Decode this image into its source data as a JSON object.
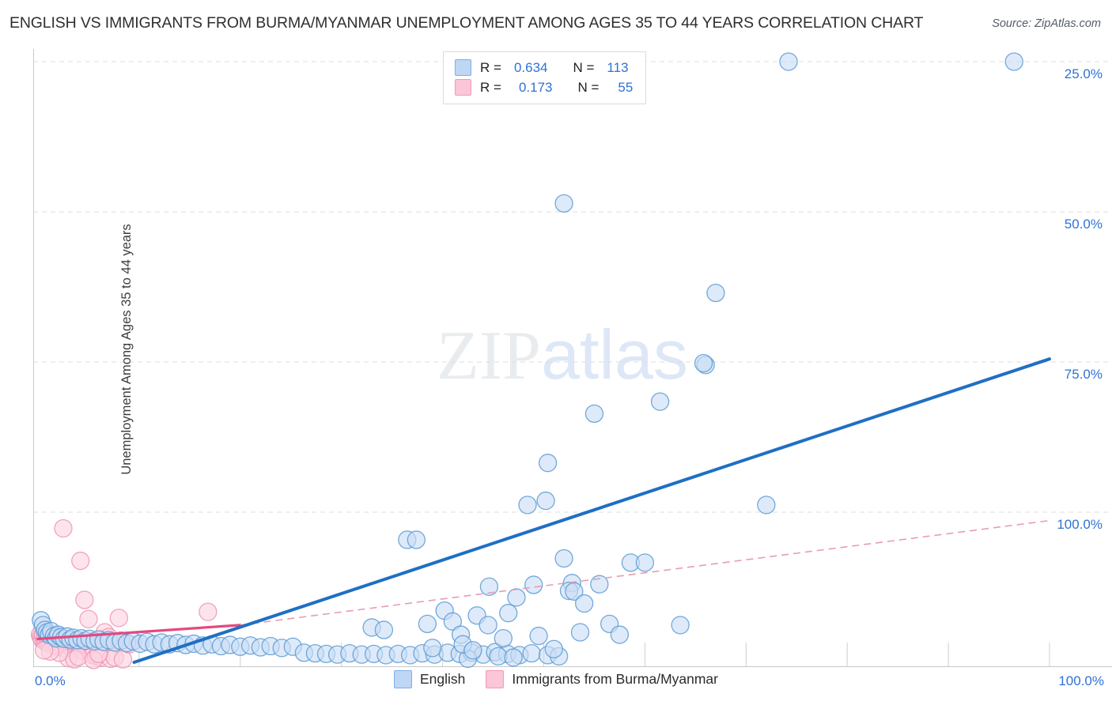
{
  "header": {
    "title": "ENGLISH VS IMMIGRANTS FROM BURMA/MYANMAR UNEMPLOYMENT AMONG AGES 35 TO 44 YEARS CORRELATION CHART",
    "source": "Source: ZipAtlas.com"
  },
  "watermark": {
    "part1": "ZIP",
    "part2": "atlas"
  },
  "stats": {
    "rows": [
      {
        "series": "English",
        "r_label": "R =",
        "r_value": "0.634",
        "n_label": "N =",
        "n_value": "113",
        "color": "#bdd7f5"
      },
      {
        "series": "Immigrants from Burma/Myanmar",
        "r_label": "R =",
        "r_value": "0.173",
        "n_label": "N =",
        "n_value": "55",
        "color": "#fbc6d8"
      }
    ]
  },
  "legend": {
    "items": [
      {
        "label": "English",
        "color": "#bdd7f5",
        "border": "#80aee4"
      },
      {
        "label": "Immigrants from Burma/Myanmar",
        "color": "#fbc6d8",
        "border": "#f29ab8"
      }
    ]
  },
  "axes": {
    "y_title": "Unemployment Among Ages 35 to 44 years",
    "y_ticks": [
      "100.0%",
      "75.0%",
      "50.0%",
      "25.0%"
    ],
    "x_min_label": "0.0%",
    "x_max_label": "100.0%"
  },
  "colors": {
    "blue_fill": "#c9ddf6",
    "blue_stroke": "#5b9bd5",
    "pink_fill": "#fbd4e1",
    "pink_stroke": "#ef95b5",
    "blue_line": "#1f6fc4",
    "pink_line": "#e4497f",
    "pink_dash": "#e89cb4",
    "grid": "#dcdcdc",
    "tick_text": "#2f72d6"
  },
  "chart_data": {
    "type": "scatter",
    "title": "ENGLISH VS IMMIGRANTS FROM BURMA/MYANMAR UNEMPLOYMENT AMONG AGES 35 TO 44 YEARS CORRELATION CHART",
    "xlabel": "",
    "ylabel": "Unemployment Among Ages 35 to 44 years",
    "xlim": [
      0,
      100
    ],
    "ylim": [
      0,
      104
    ],
    "grid": true,
    "x_tick_values": [
      0,
      100
    ],
    "y_tick_values": [
      25,
      50,
      75,
      100
    ],
    "legend_position": "bottom-center",
    "series": [
      {
        "name": "English",
        "r": 0.634,
        "n": 113,
        "color": "#c9ddf6",
        "stroke": "#5b9bd5",
        "trend": {
          "type": "solid",
          "x0": 9.5,
          "y0": 0.0,
          "x1": 100.0,
          "y1": 50.5
        },
        "points": [
          [
            0.3,
            7.0
          ],
          [
            0.5,
            6.2
          ],
          [
            0.7,
            5.4
          ],
          [
            0.9,
            5.0
          ],
          [
            1.1,
            4.6
          ],
          [
            1.3,
            5.2
          ],
          [
            1.6,
            4.4
          ],
          [
            1.8,
            4.0
          ],
          [
            2.0,
            4.6
          ],
          [
            2.3,
            4.2
          ],
          [
            2.6,
            3.9
          ],
          [
            2.9,
            4.3
          ],
          [
            3.2,
            3.8
          ],
          [
            3.5,
            4.1
          ],
          [
            3.9,
            3.7
          ],
          [
            4.3,
            4.0
          ],
          [
            4.7,
            3.6
          ],
          [
            5.1,
            3.9
          ],
          [
            5.6,
            3.5
          ],
          [
            6.0,
            3.8
          ],
          [
            6.5,
            3.4
          ],
          [
            7.0,
            3.7
          ],
          [
            7.6,
            3.3
          ],
          [
            8.2,
            3.6
          ],
          [
            8.8,
            3.2
          ],
          [
            9.4,
            3.5
          ],
          [
            10.1,
            3.1
          ],
          [
            10.8,
            3.4
          ],
          [
            11.5,
            3.0
          ],
          [
            12.2,
            3.3
          ],
          [
            13.0,
            3.0
          ],
          [
            13.8,
            3.2
          ],
          [
            14.6,
            2.9
          ],
          [
            15.4,
            3.1
          ],
          [
            16.3,
            2.8
          ],
          [
            17.2,
            3.0
          ],
          [
            18.1,
            2.7
          ],
          [
            19.0,
            2.9
          ],
          [
            20.0,
            2.6
          ],
          [
            21.0,
            2.8
          ],
          [
            22.0,
            2.5
          ],
          [
            23.0,
            2.7
          ],
          [
            24.1,
            2.4
          ],
          [
            25.2,
            2.6
          ],
          [
            26.3,
            1.6
          ],
          [
            27.4,
            1.5
          ],
          [
            28.5,
            1.4
          ],
          [
            29.6,
            1.3
          ],
          [
            30.8,
            1.5
          ],
          [
            32.0,
            1.3
          ],
          [
            33.2,
            1.4
          ],
          [
            34.4,
            1.2
          ],
          [
            35.6,
            1.4
          ],
          [
            36.8,
            1.2
          ],
          [
            38.0,
            1.5
          ],
          [
            39.2,
            1.3
          ],
          [
            40.5,
            1.6
          ],
          [
            41.7,
            1.4
          ],
          [
            42.9,
            1.6
          ],
          [
            44.0,
            1.3
          ],
          [
            45.2,
            1.7
          ],
          [
            46.4,
            1.4
          ],
          [
            47.6,
            1.2
          ],
          [
            48.8,
            1.5
          ],
          [
            33.0,
            5.8
          ],
          [
            34.2,
            5.4
          ],
          [
            36.5,
            20.4
          ],
          [
            37.4,
            20.4
          ],
          [
            39.0,
            2.4
          ],
          [
            40.2,
            8.6
          ],
          [
            41.0,
            6.8
          ],
          [
            41.8,
            4.6
          ],
          [
            42.5,
            0.6
          ],
          [
            43.4,
            7.8
          ],
          [
            44.5,
            6.2
          ],
          [
            45.5,
            1.0
          ],
          [
            46.5,
            8.2
          ],
          [
            47.3,
            10.8
          ],
          [
            48.4,
            26.2
          ],
          [
            49.5,
            4.4
          ],
          [
            50.4,
            1.2
          ],
          [
            51.5,
            1.0
          ],
          [
            52.8,
            13.2
          ],
          [
            53.6,
            5.0
          ],
          [
            44.6,
            12.6
          ],
          [
            46.0,
            4.0
          ],
          [
            47.0,
            0.8
          ],
          [
            49.0,
            12.9
          ],
          [
            50.2,
            26.9
          ],
          [
            50.4,
            33.2
          ],
          [
            52.0,
            17.3
          ],
          [
            52.5,
            11.9
          ],
          [
            53.0,
            11.8
          ],
          [
            54.0,
            9.8
          ],
          [
            55.0,
            41.4
          ],
          [
            56.5,
            6.4
          ],
          [
            57.5,
            4.6
          ],
          [
            58.6,
            16.6
          ],
          [
            60.0,
            16.6
          ],
          [
            61.5,
            43.4
          ],
          [
            63.5,
            6.2
          ],
          [
            66.0,
            49.5
          ],
          [
            65.8,
            49.8
          ],
          [
            67.0,
            61.5
          ],
          [
            52.0,
            76.4
          ],
          [
            74.2,
            100.0
          ],
          [
            96.5,
            100.0
          ],
          [
            72.0,
            26.2
          ],
          [
            55.5,
            13.0
          ],
          [
            42.0,
            3.0
          ],
          [
            43.0,
            2.0
          ],
          [
            51.0,
            2.2
          ],
          [
            38.5,
            6.4
          ]
        ]
      },
      {
        "name": "Immigrants from Burma/Myanmar",
        "r": 0.173,
        "n": 55,
        "color": "#fbd4e1",
        "stroke": "#ef95b5",
        "trend": {
          "type": "solid-then-dashed",
          "x0": 0.0,
          "y0": 3.9,
          "x_break": 20.0,
          "y_break": 6.2,
          "x1": 100.0,
          "y1": 23.6
        },
        "points": [
          [
            0.2,
            4.6
          ],
          [
            0.3,
            4.2
          ],
          [
            0.4,
            3.8
          ],
          [
            0.5,
            4.4
          ],
          [
            0.6,
            3.6
          ],
          [
            0.7,
            4.0
          ],
          [
            0.8,
            3.4
          ],
          [
            0.9,
            4.2
          ],
          [
            1.0,
            3.2
          ],
          [
            1.1,
            3.9
          ],
          [
            1.2,
            3.0
          ],
          [
            1.3,
            4.1
          ],
          [
            1.4,
            3.5
          ],
          [
            1.5,
            2.8
          ],
          [
            1.6,
            4.3
          ],
          [
            1.7,
            3.3
          ],
          [
            1.8,
            3.7
          ],
          [
            1.9,
            2.6
          ],
          [
            2.0,
            4.0
          ],
          [
            2.2,
            3.1
          ],
          [
            2.4,
            3.6
          ],
          [
            2.6,
            2.4
          ],
          [
            2.8,
            3.8
          ],
          [
            3.0,
            2.9
          ],
          [
            3.2,
            3.4
          ],
          [
            3.4,
            2.2
          ],
          [
            3.6,
            3.5
          ],
          [
            3.8,
            2.7
          ],
          [
            4.0,
            3.2
          ],
          [
            4.3,
            2.0
          ],
          [
            4.6,
            3.0
          ],
          [
            5.0,
            2.5
          ],
          [
            5.4,
            1.2
          ],
          [
            5.8,
            1.0
          ],
          [
            6.2,
            0.8
          ],
          [
            2.5,
            22.3
          ],
          [
            4.2,
            16.9
          ],
          [
            4.6,
            10.4
          ],
          [
            5.0,
            7.2
          ],
          [
            7.2,
            0.6
          ],
          [
            7.6,
            0.8
          ],
          [
            3.0,
            0.7
          ],
          [
            3.6,
            0.5
          ],
          [
            4.0,
            0.9
          ],
          [
            5.5,
            0.4
          ],
          [
            6.0,
            1.4
          ],
          [
            2.1,
            1.6
          ],
          [
            1.2,
            1.8
          ],
          [
            0.6,
            2.0
          ],
          [
            8.0,
            7.4
          ],
          [
            8.4,
            0.5
          ],
          [
            16.8,
            8.4
          ],
          [
            6.6,
            5.0
          ],
          [
            7.0,
            4.2
          ],
          [
            9.0,
            3.0
          ]
        ]
      }
    ]
  }
}
